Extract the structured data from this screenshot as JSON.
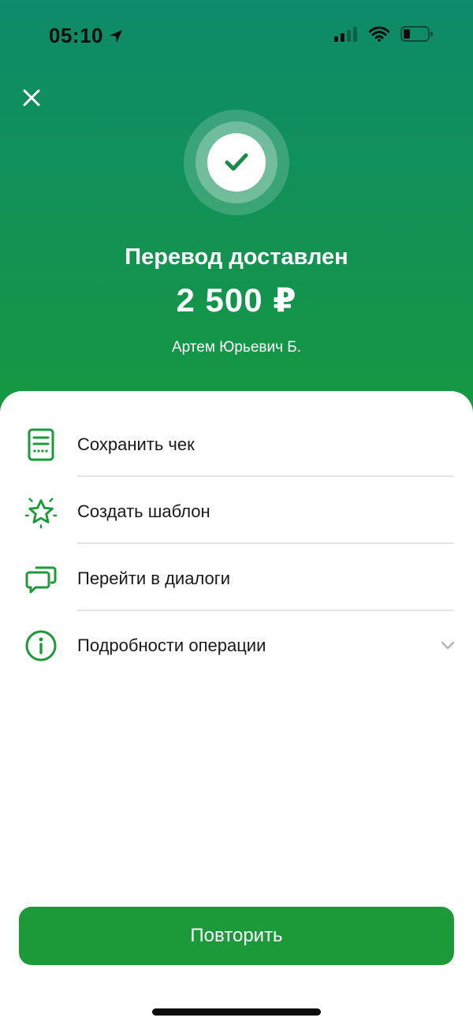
{
  "status_bar": {
    "time": "05:10",
    "icons": [
      "location-arrow-icon",
      "cellular-signal-icon",
      "wifi-icon",
      "battery-icon"
    ]
  },
  "header": {
    "close_icon": "close-icon",
    "success_icon": "checkmark-icon",
    "title": "Перевод доставлен",
    "amount": "2 500 ₽",
    "recipient": "Артем Юрьевич Б."
  },
  "actions": [
    {
      "label": "Сохранить чек",
      "icon": "receipt-icon"
    },
    {
      "label": "Создать шаблон",
      "icon": "star-icon"
    },
    {
      "label": "Перейти в диалоги",
      "icon": "chat-bubbles-icon"
    },
    {
      "label": "Подробности операции",
      "icon": "info-icon",
      "expandable": true
    }
  ],
  "repeat_button": {
    "label": "Повторить"
  },
  "colors": {
    "brand_green": "#1c9a3a",
    "gradient_top": "#0d8b6a",
    "gradient_bottom": "#16993f",
    "text": "#1a1a1a"
  }
}
